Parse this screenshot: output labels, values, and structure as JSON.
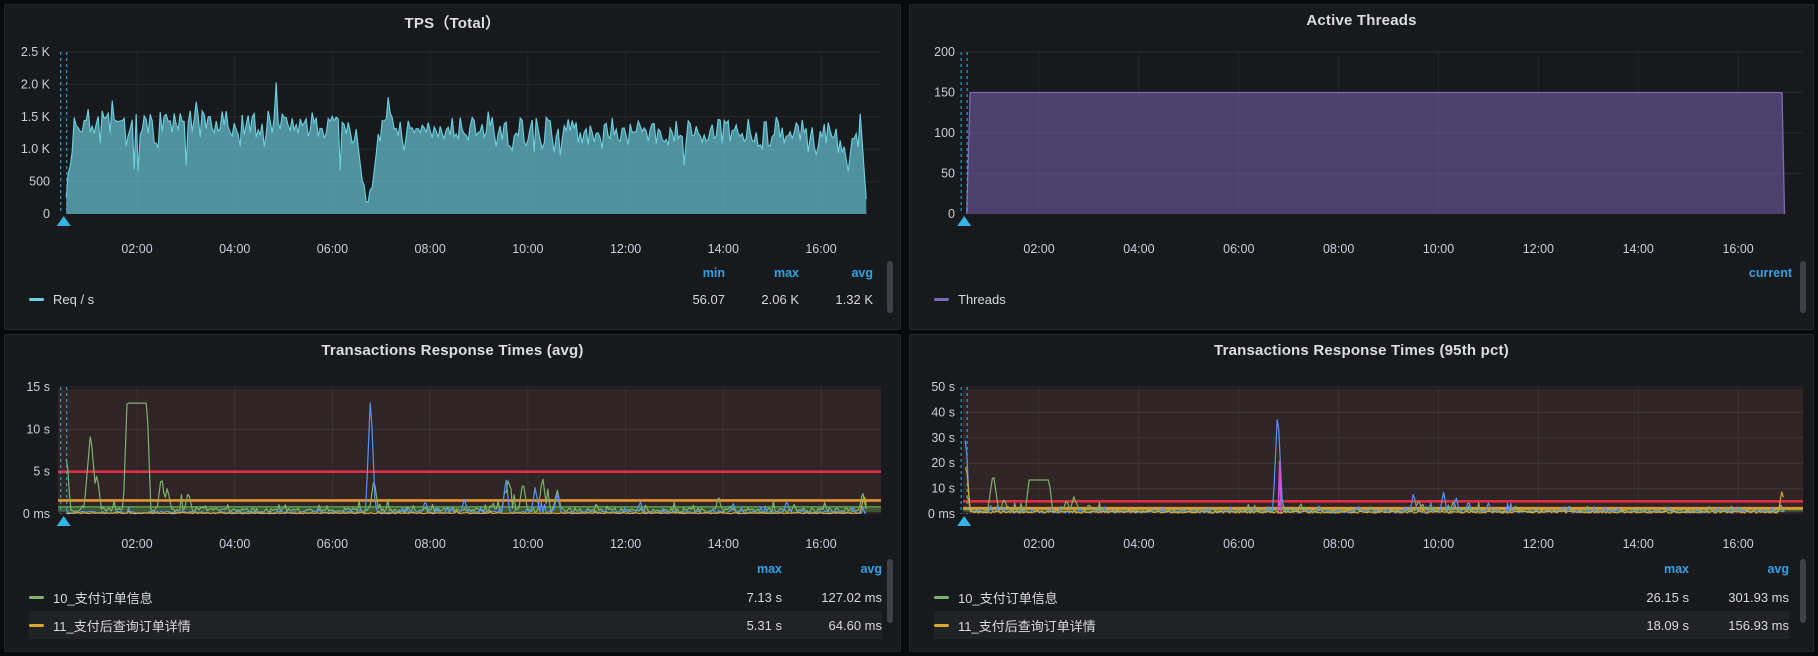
{
  "colors": {
    "accent_blue": "#33a2e5",
    "annotation_cyan": "#33b5e5",
    "tps_line": "#6ed0e0",
    "threads_line": "#7e69b4",
    "green_series": "#7eb26d",
    "yellow_series": "#d9a92e",
    "blue_series": "#5794f2",
    "magenta_series": "#d24fd2",
    "threshold_red": "#e02f44",
    "threshold_orange": "#e5952f"
  },
  "panels": [
    {
      "title": "TPS（Total）",
      "legend": {
        "headers": [
          "min",
          "max",
          "avg"
        ],
        "rows": [
          {
            "label": "Req / s",
            "color": "#6ed0e0",
            "values": [
              "56.07",
              "2.06 K",
              "1.32 K"
            ]
          }
        ]
      }
    },
    {
      "title": "Active Threads",
      "legend": {
        "headers": [
          "current"
        ],
        "rows": [
          {
            "label": "Threads",
            "color": "#7e69b4",
            "values": [
              ""
            ]
          }
        ]
      }
    },
    {
      "title": "Transactions Response Times (avg)",
      "legend": {
        "headers": [
          "max",
          "avg"
        ],
        "rows": [
          {
            "label": "10_支付订单信息",
            "color": "#7eb26d",
            "values": [
              "7.13 s",
              "127.02 ms"
            ]
          },
          {
            "label": "11_支付后查询订单详情",
            "color": "#d9a92e",
            "values": [
              "5.31 s",
              "64.60 ms"
            ]
          }
        ]
      }
    },
    {
      "title": "Transactions Response Times (95th pct)",
      "legend": {
        "headers": [
          "max",
          "avg"
        ],
        "rows": [
          {
            "label": "10_支付订单信息",
            "color": "#7eb26d",
            "values": [
              "26.15 s",
              "301.93 ms"
            ]
          },
          {
            "label": "11_支付后查询订单详情",
            "color": "#d9a92e",
            "values": [
              "18.09 s",
              "156.93 ms"
            ]
          }
        ]
      }
    }
  ],
  "chart_data": [
    {
      "type": "area",
      "title": "TPS（Total）",
      "ylabel": "Req / s",
      "ylim": [
        0,
        2500
      ],
      "yticks": [
        {
          "v": 0,
          "label": "0"
        },
        {
          "v": 500,
          "label": "500"
        },
        {
          "v": 1000,
          "label": "1.0 K"
        },
        {
          "v": 1500,
          "label": "1.5 K"
        },
        {
          "v": 2000,
          "label": "2.0 K"
        },
        {
          "v": 2500,
          "label": "2.5 K"
        }
      ],
      "xticks": [
        {
          "t": 2,
          "label": "02:00"
        },
        {
          "t": 4,
          "label": "04:00"
        },
        {
          "t": 6,
          "label": "06:00"
        },
        {
          "t": 8,
          "label": "08:00"
        },
        {
          "t": 10,
          "label": "10:00"
        },
        {
          "t": 12,
          "label": "12:00"
        },
        {
          "t": 14,
          "label": "14:00"
        },
        {
          "t": 16,
          "label": "16:00"
        }
      ],
      "annotation_t": 0.5,
      "stats": {
        "min": 56.07,
        "max": 2060,
        "avg": 1320
      },
      "series": [
        {
          "name": "Req / s",
          "kind": "noisy-area",
          "seed": 7,
          "color": "#6ed0e0",
          "fill": "rgba(110,208,224,0.66)",
          "t_start": 0.55,
          "t_end": 16.93,
          "envelope": [
            [
              0.55,
              1420
            ],
            [
              6.1,
              1400
            ],
            [
              6.45,
              1330
            ],
            [
              7.0,
              1480
            ],
            [
              7.5,
              1320
            ],
            [
              12,
              1290
            ],
            [
              17,
              1270
            ]
          ],
          "noise": 0.15,
          "dip_p": 0.28,
          "dip_f": 0.78,
          "spikes": [
            [
              1.5,
              1880
            ],
            [
              3.2,
              1900
            ],
            [
              4.85,
              2060
            ],
            [
              5.6,
              1780
            ],
            [
              7.15,
              1950
            ],
            [
              9.2,
              1760
            ],
            [
              13.3,
              1700
            ],
            [
              15.1,
              1750
            ]
          ],
          "dips": [
            [
              6.55,
              900
            ],
            [
              6.63,
              380
            ],
            [
              6.71,
              56
            ],
            [
              6.79,
              260
            ],
            [
              6.86,
              750
            ],
            [
              16.55,
              620
            ]
          ]
        }
      ]
    },
    {
      "type": "area",
      "title": "Active Threads",
      "ylabel": "Threads",
      "ylim": [
        0,
        200
      ],
      "yticks": [
        {
          "v": 0,
          "label": "0"
        },
        {
          "v": 50,
          "label": "50"
        },
        {
          "v": 100,
          "label": "100"
        },
        {
          "v": 150,
          "label": "150"
        },
        {
          "v": 200,
          "label": "200"
        }
      ],
      "xticks": [
        {
          "t": 2,
          "label": "02:00"
        },
        {
          "t": 4,
          "label": "04:00"
        },
        {
          "t": 6,
          "label": "06:00"
        },
        {
          "t": 8,
          "label": "08:00"
        },
        {
          "t": 10,
          "label": "10:00"
        },
        {
          "t": 12,
          "label": "12:00"
        },
        {
          "t": 14,
          "label": "14:00"
        },
        {
          "t": 16,
          "label": "16:00"
        }
      ],
      "annotation_t": 0.5,
      "stats": {
        "current": null
      },
      "series": [
        {
          "name": "Threads",
          "kind": "flat-area",
          "seed": 1,
          "color": "#7e69b4",
          "fill": "rgba(125,100,185,0.52)",
          "points": [
            [
              0.55,
              0
            ],
            [
              0.62,
              150
            ],
            [
              16.88,
              150
            ],
            [
              16.93,
              0
            ]
          ]
        }
      ]
    },
    {
      "type": "line",
      "title": "Transactions Response Times (avg)",
      "ylim": [
        0,
        15
      ],
      "yticks": [
        {
          "v": 0,
          "label": "0 ms"
        },
        {
          "v": 5,
          "label": "5 s"
        },
        {
          "v": 10,
          "label": "10 s"
        },
        {
          "v": 15,
          "label": "15 s"
        }
      ],
      "xticks": [
        {
          "t": 2,
          "label": "02:00"
        },
        {
          "t": 4,
          "label": "04:00"
        },
        {
          "t": 6,
          "label": "06:00"
        },
        {
          "t": 8,
          "label": "08:00"
        },
        {
          "t": 10,
          "label": "10:00"
        },
        {
          "t": 12,
          "label": "12:00"
        },
        {
          "t": 14,
          "label": "14:00"
        },
        {
          "t": 16,
          "label": "16:00"
        }
      ],
      "annotation_t": 0.5,
      "plot_bg": "#2f2426",
      "thresholds": {
        "red_line": 5,
        "orange_line": 1.6,
        "green_band": [
          0.25,
          0.85
        ]
      },
      "series": [
        {
          "name": "10_支付订单信息",
          "kind": "spiky",
          "seed": 11,
          "color": "#7eb26d",
          "t_start": 0.55,
          "t_end": 16.93,
          "base": 0.45,
          "amp": 0.28,
          "bump_p": 0.1,
          "bump_amp": 0.9,
          "regions": [
            [
              1.0,
              3.4,
              2.0
            ],
            [
              6.5,
              7.3,
              1.6
            ],
            [
              9.2,
              11.2,
              2.6
            ],
            [
              16.0,
              17.0,
              1.3
            ]
          ],
          "spikes": [
            [
              0.56,
              7.4,
              2
            ],
            [
              1.05,
              9.7,
              5
            ],
            [
              1.18,
              4.8,
              3
            ],
            [
              2.0,
              13.1,
              20
            ],
            [
              2.5,
              4.6,
              3
            ],
            [
              2.62,
              3.2,
              3
            ],
            [
              3.05,
              2.6,
              3
            ],
            [
              6.85,
              4.2,
              3
            ],
            [
              9.6,
              4.4,
              3
            ],
            [
              9.9,
              3.9,
              3
            ],
            [
              10.3,
              4.5,
              3
            ],
            [
              10.6,
              2.9,
              3
            ],
            [
              13.9,
              2.2,
              2
            ],
            [
              16.85,
              2.7,
              2
            ]
          ]
        },
        {
          "name": "blue",
          "kind": "spiky",
          "seed": 23,
          "color": "#5794f2",
          "t_start": 0.55,
          "t_end": 16.93,
          "base": 0.2,
          "amp": 0.12,
          "bump_p": 0.08,
          "bump_amp": 0.7,
          "regions": [
            [
              9.2,
              11.2,
              1.6
            ]
          ],
          "spikes": [
            [
              6.78,
              14.2,
              3
            ],
            [
              9.55,
              4.3,
              2
            ],
            [
              10.15,
              3.3,
              2
            ],
            [
              10.6,
              2.5,
              2
            ],
            [
              7.9,
              1.6,
              2
            ],
            [
              8.7,
              1.8,
              2
            ],
            [
              12.3,
              1.5,
              2
            ],
            [
              14.2,
              1.3,
              2
            ],
            [
              15.3,
              1.6,
              2
            ]
          ]
        },
        {
          "name": "11_支付后查询订单详情",
          "kind": "spiky",
          "seed": 31,
          "color": "#d9a92e",
          "t_start": 0.55,
          "t_end": 16.93,
          "base": 0.1,
          "amp": 0.06,
          "bump_p": 0.04,
          "bump_amp": 0.3,
          "regions": [],
          "spikes": [
            [
              16.88,
              2.3,
              2
            ]
          ]
        }
      ]
    },
    {
      "type": "line",
      "title": "Transactions Response Times (95th pct)",
      "ylim": [
        0,
        50
      ],
      "yticks": [
        {
          "v": 0,
          "label": "0 ms"
        },
        {
          "v": 10,
          "label": "10 s"
        },
        {
          "v": 20,
          "label": "20 s"
        },
        {
          "v": 30,
          "label": "30 s"
        },
        {
          "v": 40,
          "label": "40 s"
        },
        {
          "v": 50,
          "label": "50 s"
        }
      ],
      "xticks": [
        {
          "t": 2,
          "label": "02:00"
        },
        {
          "t": 4,
          "label": "04:00"
        },
        {
          "t": 6,
          "label": "06:00"
        },
        {
          "t": 8,
          "label": "08:00"
        },
        {
          "t": 10,
          "label": "10:00"
        },
        {
          "t": 12,
          "label": "12:00"
        },
        {
          "t": 14,
          "label": "14:00"
        },
        {
          "t": 16,
          "label": "16:00"
        }
      ],
      "annotation_t": 0.5,
      "plot_bg": "#2f2426",
      "thresholds": {
        "red_line": 5,
        "orange_line": 2.3,
        "green_band": [
          0.9,
          1.8
        ]
      },
      "series": [
        {
          "name": "10_支付订单信息",
          "kind": "spiky",
          "seed": 41,
          "color": "#7eb26d",
          "t_start": 0.55,
          "t_end": 16.93,
          "base": 1.3,
          "amp": 0.7,
          "bump_p": 0.12,
          "bump_amp": 1.8,
          "regions": [
            [
              1.0,
              3.4,
              1.8
            ],
            [
              6.5,
              7.3,
              1.3
            ],
            [
              9.2,
              11.2,
              1.6
            ]
          ],
          "spikes": [
            [
              0.56,
              8,
              2
            ],
            [
              1.08,
              16.3,
              4
            ],
            [
              1.3,
              6.2,
              3
            ],
            [
              2.0,
              13.4,
              20
            ],
            [
              2.55,
              5.6,
              3
            ],
            [
              2.7,
              7.0,
              3
            ],
            [
              3.0,
              4.0,
              3
            ],
            [
              6.85,
              6.0,
              3
            ],
            [
              9.6,
              5.5,
              3
            ],
            [
              10.3,
              5.0,
              3
            ],
            [
              16.85,
              4.0,
              2
            ]
          ]
        },
        {
          "name": "blue",
          "kind": "spiky",
          "seed": 53,
          "color": "#5794f2",
          "t_start": 0.52,
          "t_end": 16.93,
          "base": 0.9,
          "amp": 0.5,
          "bump_p": 0.1,
          "bump_amp": 2.2,
          "regions": [
            [
              9.0,
              11.5,
              1.8
            ]
          ],
          "spikes": [
            [
              0.53,
              33,
              2
            ],
            [
              6.78,
              41.8,
              3
            ],
            [
              9.5,
              8.4,
              2
            ],
            [
              10.1,
              8.7,
              2
            ],
            [
              10.35,
              6.9,
              2
            ],
            [
              10.6,
              5.2,
              2
            ],
            [
              11.0,
              4.4,
              2
            ],
            [
              7.6,
              3.2,
              2
            ],
            [
              8.4,
              3.0,
              2
            ],
            [
              12.5,
              3.0,
              2
            ],
            [
              13.6,
              2.6,
              2
            ],
            [
              14.6,
              3.1,
              2
            ],
            [
              15.6,
              2.8,
              2
            ]
          ]
        },
        {
          "name": "magenta",
          "kind": "poly",
          "seed": 1,
          "color": "#d24fd2",
          "points": [
            [
              6.79,
              0
            ],
            [
              6.82,
              21
            ],
            [
              6.85,
              0
            ]
          ]
        },
        {
          "name": "11_支付后查询订单详情",
          "kind": "spiky",
          "seed": 61,
          "color": "#d9a92e",
          "t_start": 0.53,
          "t_end": 16.93,
          "base": 0.75,
          "amp": 0.4,
          "bump_p": 0.05,
          "bump_amp": 0.8,
          "regions": [],
          "spikes": [
            [
              0.54,
              21,
              2
            ],
            [
              16.88,
              9.6,
              2
            ]
          ]
        }
      ]
    }
  ]
}
